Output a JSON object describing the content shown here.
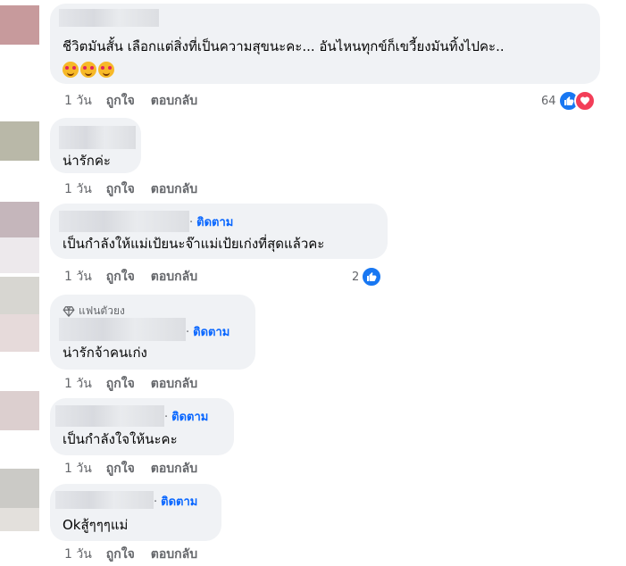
{
  "comments": [
    {
      "text": "ชีวิตมันสั้น เลือกแต่สิ่งที่เป็นความสุขนะคะ... อันไหนทุกข์ก็เขวี้ยงมันทิ้งไปคะ..",
      "emoji_count": 3,
      "time": "1 วัน",
      "like": "ถูกใจ",
      "reply": "ตอบกลับ",
      "reaction_count": "64"
    },
    {
      "text": "น่ารักค่ะ",
      "time": "1 วัน",
      "like": "ถูกใจ",
      "reply": "ตอบกลับ"
    },
    {
      "text": "เป็นกำลังให้แม่เป้ยนะจ๊าแม่เป้ยเก่งที่สุดแล้วคะ",
      "follow": "ติดตาม",
      "separator": "·",
      "time": "1 วัน",
      "like": "ถูกใจ",
      "reply": "ตอบกลับ",
      "reaction_count": "2"
    },
    {
      "badge": "แฟนตัวยง",
      "text": "น่ารักจ้าคนเก่ง",
      "follow": "ติดตาม",
      "separator": "·",
      "time": "1 วัน",
      "like": "ถูกใจ",
      "reply": "ตอบกลับ"
    },
    {
      "text": "เป็นกำลังใจให้นะคะ",
      "follow": "ติดตาม",
      "separator": "·",
      "time": "1 วัน",
      "like": "ถูกใจ",
      "reply": "ตอบกลับ"
    },
    {
      "text": "Okสู้ๆๆๆแม่",
      "follow": "ติดตาม",
      "separator": "·",
      "time": "1 วัน",
      "like": "ถูกใจ",
      "reply": "ตอบกลับ"
    }
  ],
  "colors": {
    "link": "#0866ff",
    "muted": "#65676b",
    "bubble": "#f0f2f5",
    "like": "#1877f2",
    "love": "#f33e58"
  },
  "icons": {
    "like": "thumbs-up-icon",
    "love": "heart-icon",
    "badge": "diamond-icon"
  }
}
